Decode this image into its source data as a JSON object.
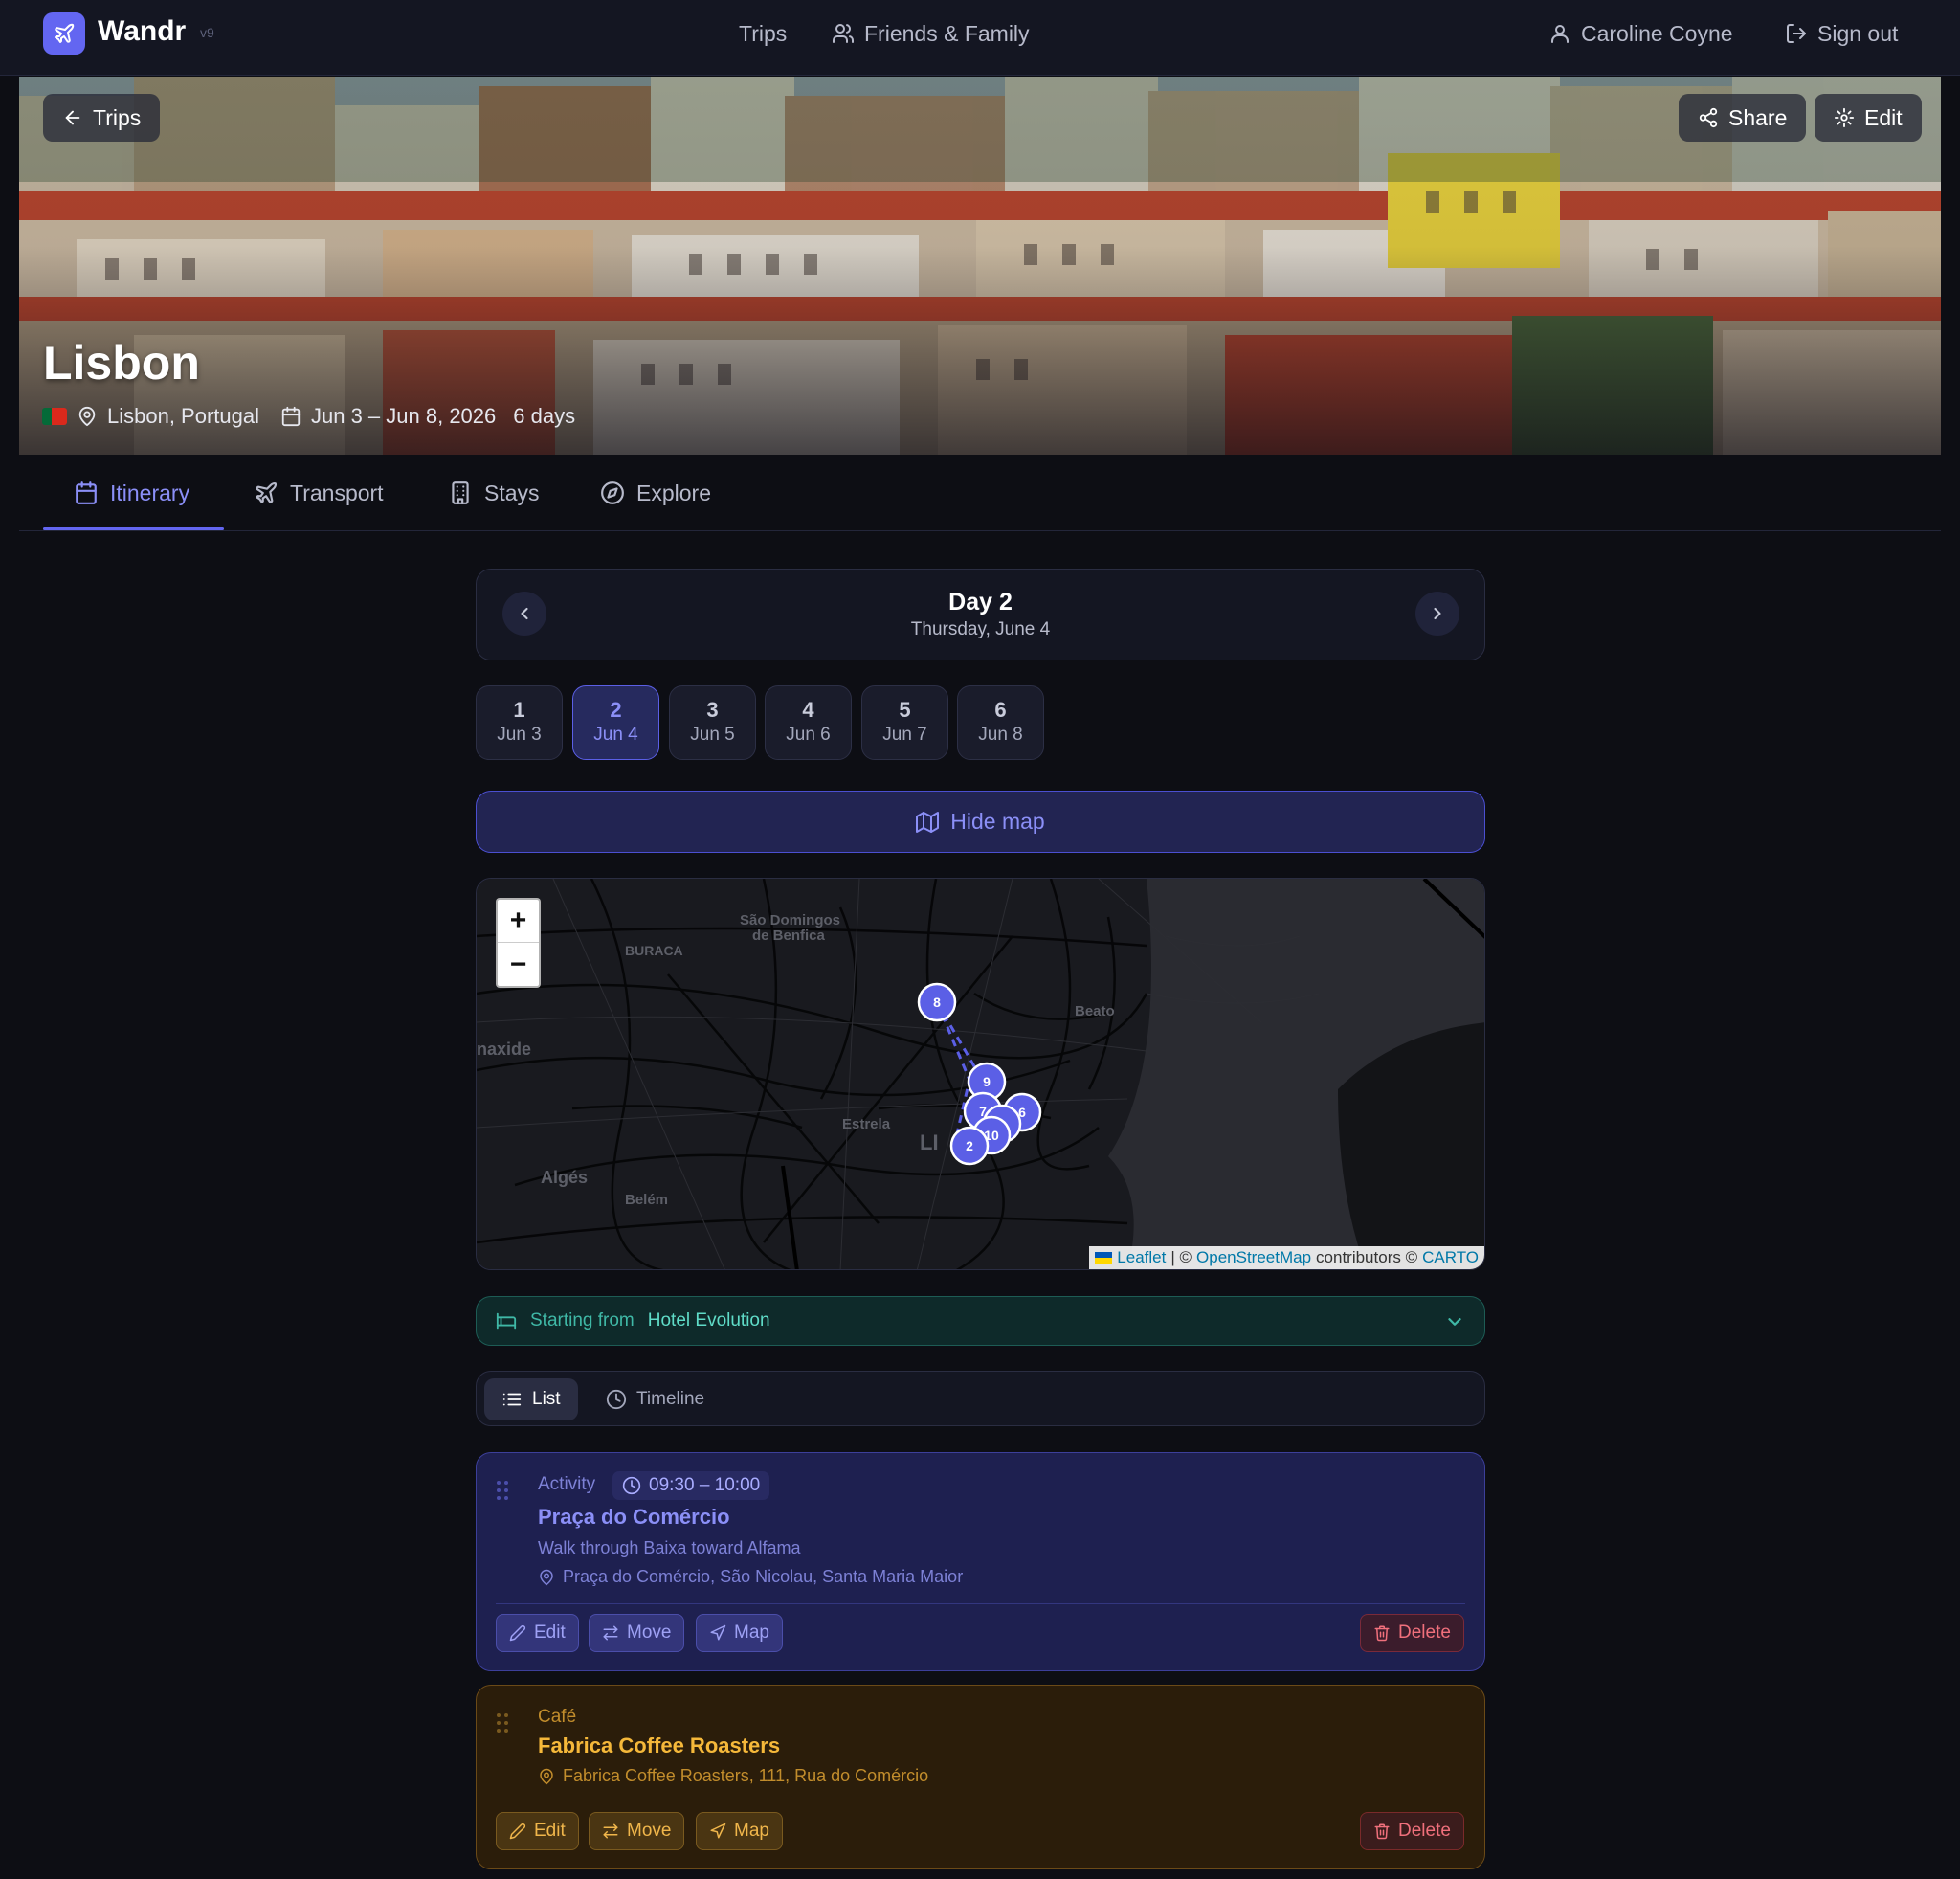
{
  "app": {
    "name": "Wandr",
    "version": "v9"
  },
  "nav": {
    "trips": "Trips",
    "friends": "Friends & Family",
    "user": "Caroline Coyne",
    "signout": "Sign out"
  },
  "hero": {
    "back_label": "Trips",
    "share_label": "Share",
    "edit_label": "Edit",
    "title": "Lisbon",
    "location": "Lisbon, Portugal",
    "dates": "Jun 3 – Jun 8, 2026",
    "duration": "6 days",
    "flag_colors": [
      "#046a38",
      "#da291c"
    ]
  },
  "tabs": [
    {
      "label": "Itinerary",
      "icon": "calendar-icon",
      "active": true
    },
    {
      "label": "Transport",
      "icon": "plane-icon"
    },
    {
      "label": "Stays",
      "icon": "building-icon"
    },
    {
      "label": "Explore",
      "icon": "compass-icon"
    }
  ],
  "day_nav": {
    "title": "Day 2",
    "subtitle": "Thursday, June 4"
  },
  "days": [
    {
      "num": "1",
      "date": "Jun 3"
    },
    {
      "num": "2",
      "date": "Jun 4",
      "active": true
    },
    {
      "num": "3",
      "date": "Jun 5"
    },
    {
      "num": "4",
      "date": "Jun 6"
    },
    {
      "num": "5",
      "date": "Jun 7"
    },
    {
      "num": "6",
      "date": "Jun 8"
    }
  ],
  "map_toggle": {
    "label": "Hide map"
  },
  "map": {
    "zoom_in": "+",
    "zoom_out": "−",
    "place_labels": [
      "São Domingos",
      "de Benfica",
      "BURACA",
      "Beato",
      "naxide",
      "Estrela",
      "Algés",
      "Belém",
      "LI"
    ],
    "markers": [
      "8",
      "9",
      "7",
      "6",
      "10",
      "2"
    ],
    "attribution": {
      "leaflet": "Leaflet",
      "sep": "| ©",
      "osm": "OpenStreetMap",
      "contributors": "contributors ©",
      "carto": "CARTO"
    },
    "marker_color": "#5b5fe6"
  },
  "starting": {
    "prefix": "Starting from",
    "hotel": "Hotel Evolution"
  },
  "view": {
    "list": "List",
    "timeline": "Timeline"
  },
  "items": [
    {
      "category": "Activity",
      "time": "09:30 – 10:00",
      "title": "Praça do Comércio",
      "description": "Walk through Baixa toward Alfama",
      "address": "Praça do Comércio, São Nicolau, Santa Maria Maior",
      "actions": {
        "edit": "Edit",
        "move": "Move",
        "map": "Map",
        "delete": "Delete"
      }
    },
    {
      "category": "Café",
      "title": "Fabrica Coffee Roasters",
      "address": "Fabrica Coffee Roasters, 111, Rua do Comércio",
      "actions": {
        "edit": "Edit",
        "move": "Move",
        "map": "Map",
        "delete": "Delete"
      }
    }
  ],
  "colors": {
    "accent": "#6366f1",
    "background": "#0d0e14",
    "activity": "#8b8ff7",
    "cafe": "#f5b83a",
    "teal": "#3fb8a6",
    "danger": "#f0707c"
  }
}
